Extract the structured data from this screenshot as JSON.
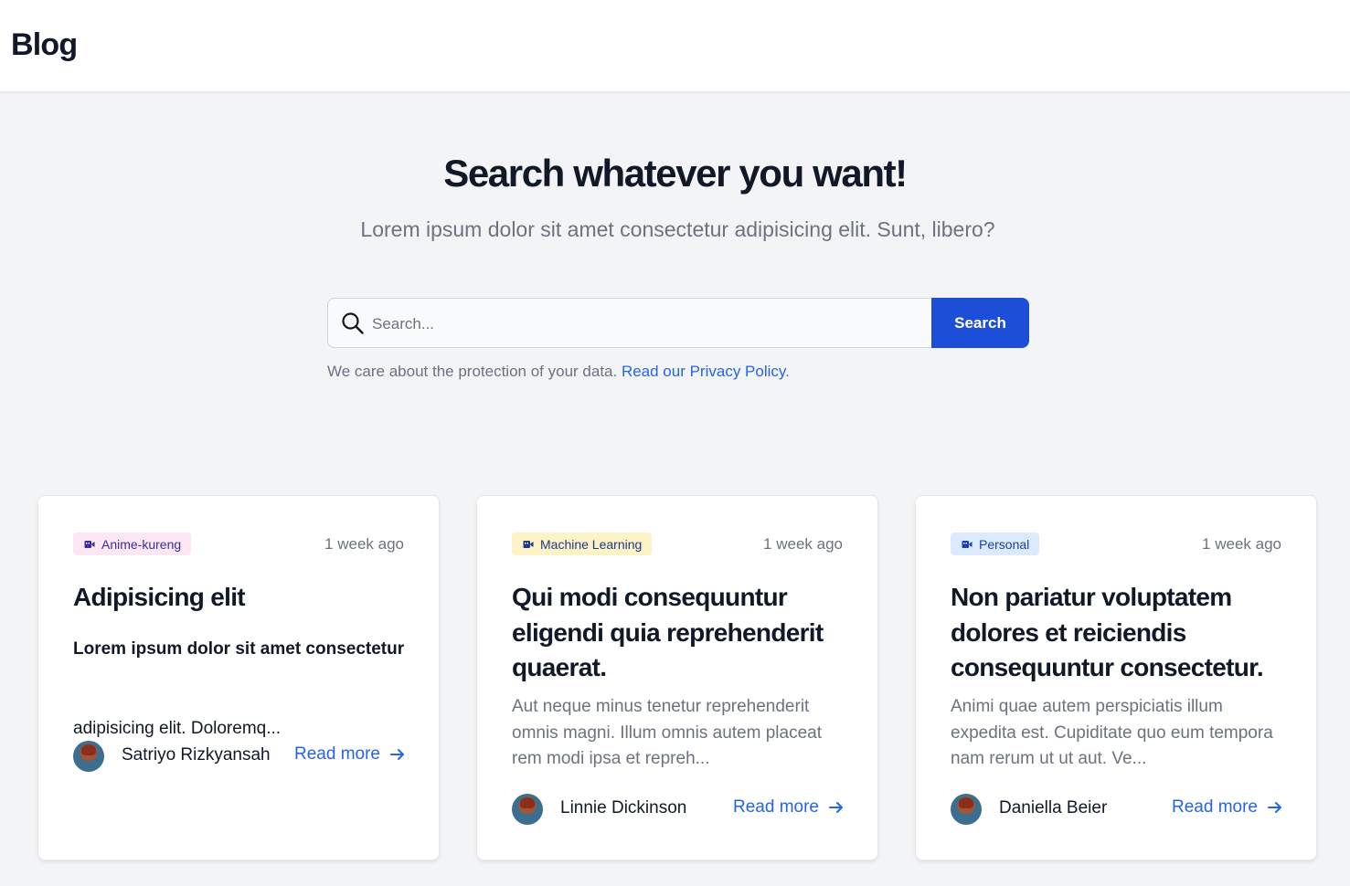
{
  "header": {
    "brand": "Blog"
  },
  "hero": {
    "title": "Search whatever you want!",
    "subtitle": "Lorem ipsum dolor sit amet consectetur adipisicing elit. Sunt, libero?"
  },
  "search": {
    "placeholder": "Search...",
    "value": "",
    "button_label": "Search",
    "icon": "search-icon"
  },
  "privacy": {
    "text": "We care about the protection of your data. ",
    "link": "Read our Privacy Policy",
    "suffix": "."
  },
  "colors": {
    "primary": "#1d4ed8",
    "link": "#2563eb",
    "background": "#f3f4f6"
  },
  "cards": [
    {
      "tag": "Anime-kureng",
      "tag_color": "#fce7f3",
      "time": "1 week ago",
      "title": "Adipisicing elit",
      "excerpt_bold": "Lorem ipsum dolor sit amet consectetur",
      "excerpt_plain": "adipisicing elit. Doloremq...",
      "author": "Satriyo Rizkyansah",
      "read_more": "Read more"
    },
    {
      "tag": "Machine Learning",
      "tag_color": "#fef3c7",
      "time": "1 week ago",
      "title": "Qui modi consequuntur eligendi quia reprehenderit quaerat.",
      "excerpt": "Aut neque minus tenetur reprehenderit omnis magni. Illum omnis autem placeat rem modi ipsa et repreh...",
      "author": "Linnie Dickinson",
      "read_more": "Read more"
    },
    {
      "tag": "Personal",
      "tag_color": "#dbeafe",
      "time": "1 week ago",
      "title": "Non pariatur voluptatem dolores et reiciendis consequuntur consectetur.",
      "excerpt": "Animi quae autem perspiciatis illum expedita est. Cupiditate quo eum tempora nam rerum ut ut aut. Ve...",
      "author": "Daniella Beier",
      "read_more": "Read more"
    }
  ]
}
